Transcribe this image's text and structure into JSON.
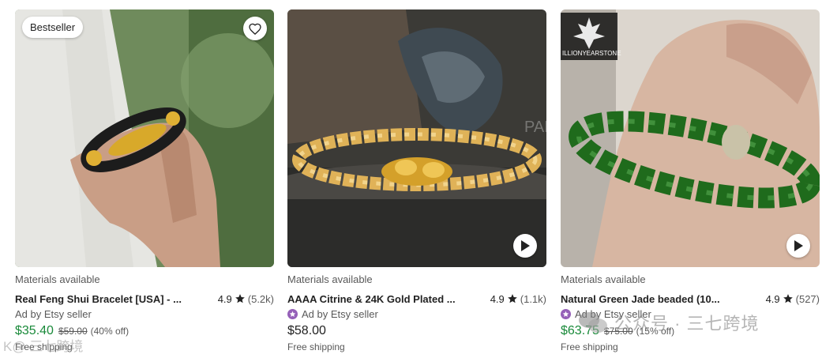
{
  "listings": [
    {
      "badge": "Bestseller",
      "materials": "Materials available",
      "title": "Real Feng Shui Bracelet [USA] - ...",
      "rating": "4.9",
      "reviews": "(5.2k)",
      "seller": "Ad by Etsy seller",
      "price": "$35.40",
      "original_price": "$59.00",
      "discount": "(40% off)",
      "shipping": "Free shipping",
      "photo_colors": {
        "bg": "#6f8b5c",
        "sleeve": "#e6e6e2",
        "skin": "#c99e86"
      }
    },
    {
      "materials": "Materials available",
      "title": "AAAA Citrine & 24K Gold Plated ...",
      "rating": "4.9",
      "reviews": "(1.1k)",
      "seller": "Ad by Etsy seller",
      "price": "$58.00",
      "shipping": "Free shipping",
      "photo_overlay": "PARK PARK",
      "photo_colors": {
        "bg": "#3b3a36",
        "rock": "#2c2c2a",
        "bead": "#e8b85a"
      }
    },
    {
      "materials": "Materials available",
      "title": "Natural Green Jade beaded (10...",
      "rating": "4.9",
      "reviews": "(527)",
      "seller": "Ad by Etsy seller",
      "price": "$63.75",
      "original_price": "$75.00",
      "discount": "(15% off)",
      "shipping": "Free shipping",
      "photo_logo_text": "ILLIONYEARSTONE",
      "photo_colors": {
        "bg": "#dcd6ce",
        "skin": "#d7b6a2",
        "jade": "#1f6b1c"
      }
    }
  ],
  "colors": {
    "sale_price": "#1a8a3a",
    "star_seller": "#9560b8"
  },
  "icons": {
    "favorite": "heart-outline-icon",
    "video": "play-icon",
    "rating": "star-icon"
  },
  "watermark": {
    "text": "公众号 · 三七跨境",
    "left_text": "K@ 三七跨境"
  }
}
